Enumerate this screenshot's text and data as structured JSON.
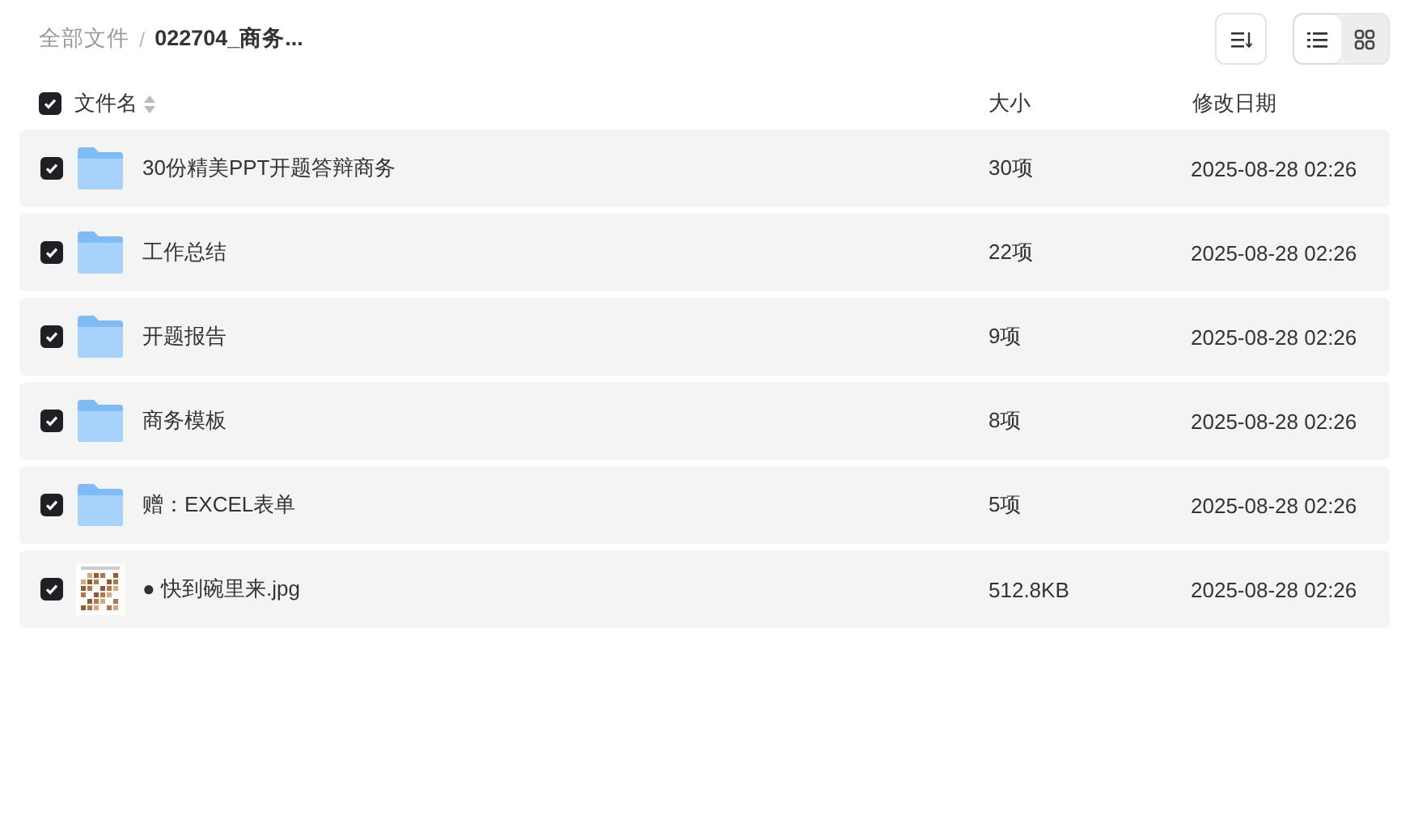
{
  "breadcrumb_separator": "/",
  "breadcrumb": [
    {
      "label": "全部文件",
      "current": false
    },
    {
      "label": "022704_商务...",
      "current": true
    }
  ],
  "view_toggle": [
    {
      "kind": "list",
      "selected": true
    },
    {
      "kind": "grid",
      "selected": false
    }
  ],
  "header": {
    "checked": true,
    "name": "文件名",
    "size": "大小",
    "date": "修改日期"
  },
  "rows": [
    {
      "kind": "folder",
      "checked": true,
      "name": "30份精美PPT开题答辩商务",
      "size": "30项",
      "date": "2025-08-28 02:26"
    },
    {
      "kind": "folder",
      "checked": true,
      "name": "工作总结",
      "size": "22项",
      "date": "2025-08-28 02:26"
    },
    {
      "kind": "folder",
      "checked": true,
      "name": "开题报告",
      "size": "9项",
      "date": "2025-08-28 02:26"
    },
    {
      "kind": "folder",
      "checked": true,
      "name": "商务模板",
      "size": "8项",
      "date": "2025-08-28 02:26"
    },
    {
      "kind": "folder",
      "checked": true,
      "name": "赠：EXCEL表单",
      "size": "5项",
      "date": "2025-08-28 02:26"
    },
    {
      "checked": true,
      "name": "● 快到碗里来.jpg",
      "size": "512.8KB",
      "date": "2025-08-28 02:26"
    }
  ]
}
